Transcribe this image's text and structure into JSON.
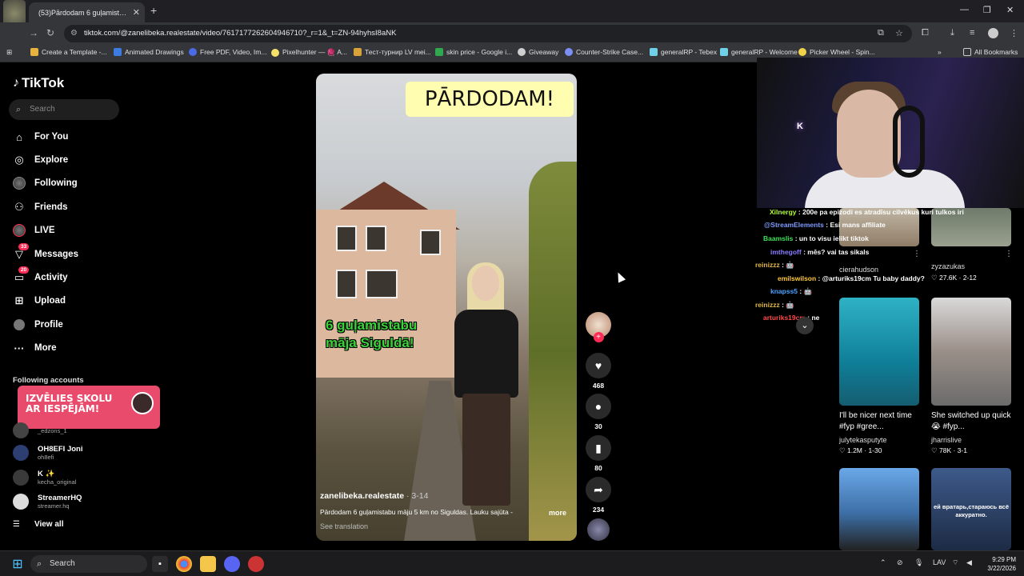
{
  "browser": {
    "tab_title": "(53)Pārdodam 6 guļamistabu m",
    "tab_close": "✕",
    "new_tab": "+",
    "url": "tiktok.com/@zanelibeka.realestate/video/7617177262604946710?_r=1&_t=ZN-94hyhsI8aNK",
    "bookmarks": [
      "Create a Template -...",
      "Animated Drawings",
      "Free PDF, Video, Im...",
      "Pixelhunter — 🧶 A...",
      "Тест-турнир LV mei...",
      "skin price - Google i...",
      "Giveaway",
      "Counter-Strike Case...",
      "generalRP - Tebex",
      "generalRP - Welcome",
      "Picker Wheel - Spin..."
    ],
    "all_bookmarks": "All Bookmarks"
  },
  "tiktok": {
    "logo": "TikTok",
    "search_placeholder": "Search",
    "nav": [
      {
        "label": "For You",
        "icon": "home-icon"
      },
      {
        "label": "Explore",
        "icon": "compass-icon"
      },
      {
        "label": "Following",
        "icon": "following-icon"
      },
      {
        "label": "Friends",
        "icon": "friends-icon"
      },
      {
        "label": "LIVE",
        "icon": "live-icon"
      },
      {
        "label": "Messages",
        "icon": "messages-icon",
        "badge": "33"
      },
      {
        "label": "Activity",
        "icon": "activity-icon",
        "badge": "20"
      },
      {
        "label": "Upload",
        "icon": "upload-icon"
      },
      {
        "label": "Profile",
        "icon": "profile-icon"
      },
      {
        "label": "More",
        "icon": "more-icon"
      }
    ],
    "following_accounts_label": "Following accounts",
    "promo_text": "IZVĒLIES SKOLU AR IESPĒJĀM!",
    "accounts": [
      {
        "name": "",
        "handle": "_edzons_1"
      },
      {
        "name": "OH8EFI Joni",
        "handle": "oh8efi"
      },
      {
        "name": "K ✨",
        "handle": "kecha_original"
      },
      {
        "name": "StreamerHQ",
        "handle": "streamer.hq"
      }
    ],
    "view_all": "View all"
  },
  "video": {
    "banner": "PĀRDODAM!",
    "overlay_line1": "6 guļamistabu",
    "overlay_line2": "māja Siguldā!",
    "author": "zanelibeka.realestate",
    "date": " · 3-14",
    "description": "Pārdodam 6 guļamistabu māju 5 km no Siguldas. Lauku sajūta -",
    "more": "more",
    "see_translation": "See translation",
    "likes": "468",
    "comments": "30",
    "saves": "80",
    "shares": "234"
  },
  "chat": [
    {
      "user": "Xilnergy",
      "color": "#b5ff3a",
      "msg": " : 200e pa epizodi es atradīsu cilvēkus kuri tulkos iri"
    },
    {
      "user": "@StreamElements",
      "color": "#7f9cff",
      "msg": " : Esi mans affiliate"
    },
    {
      "user": "Baamslis",
      "color": "#3ce05a",
      "msg": " : un to visu ielikt tiktok"
    },
    {
      "user": "imthegoff",
      "color": "#8a7dff",
      "msg": " : mēs? vai tas sikals"
    },
    {
      "user": "reinizzz",
      "color": "#e0b84a",
      "msg": " : 🤖"
    },
    {
      "user": "emilswilson",
      "color": "#ffc83a",
      "msg": " : @arturiks19cm Tu baby daddy?"
    },
    {
      "user": "knapss5",
      "color": "#4aa3ff",
      "msg": " : 🤖"
    },
    {
      "user": "reinizzz",
      "color": "#e0b84a",
      "msg": " : 🤖"
    },
    {
      "user": "arturiks19cm",
      "color": "#ff4a4a",
      "msg": " : ne"
    }
  ],
  "grid": [
    {
      "title": "",
      "user": "cierahudson",
      "stat": "",
      "date": ""
    },
    {
      "title": "",
      "user": "zyzazukas",
      "stat": "27.6K",
      "date": " · 2-12"
    },
    {
      "title": "I'll be nicer next time #fyp #gree...",
      "user": "julytekasputyte",
      "stat": "1.2M",
      "date": " · 1-30"
    },
    {
      "title": "She switched up quick 😭 #fyp...",
      "user": "jharrislive",
      "stat": "78K",
      "date": " · 3-1"
    }
  ],
  "grid_overlay_text": "ей вратарь,стараюсь всё аккуратно.",
  "taskbar": {
    "search": "Search",
    "lang": "LAV",
    "time": "9:29 PM",
    "date": "3/22/2026"
  }
}
